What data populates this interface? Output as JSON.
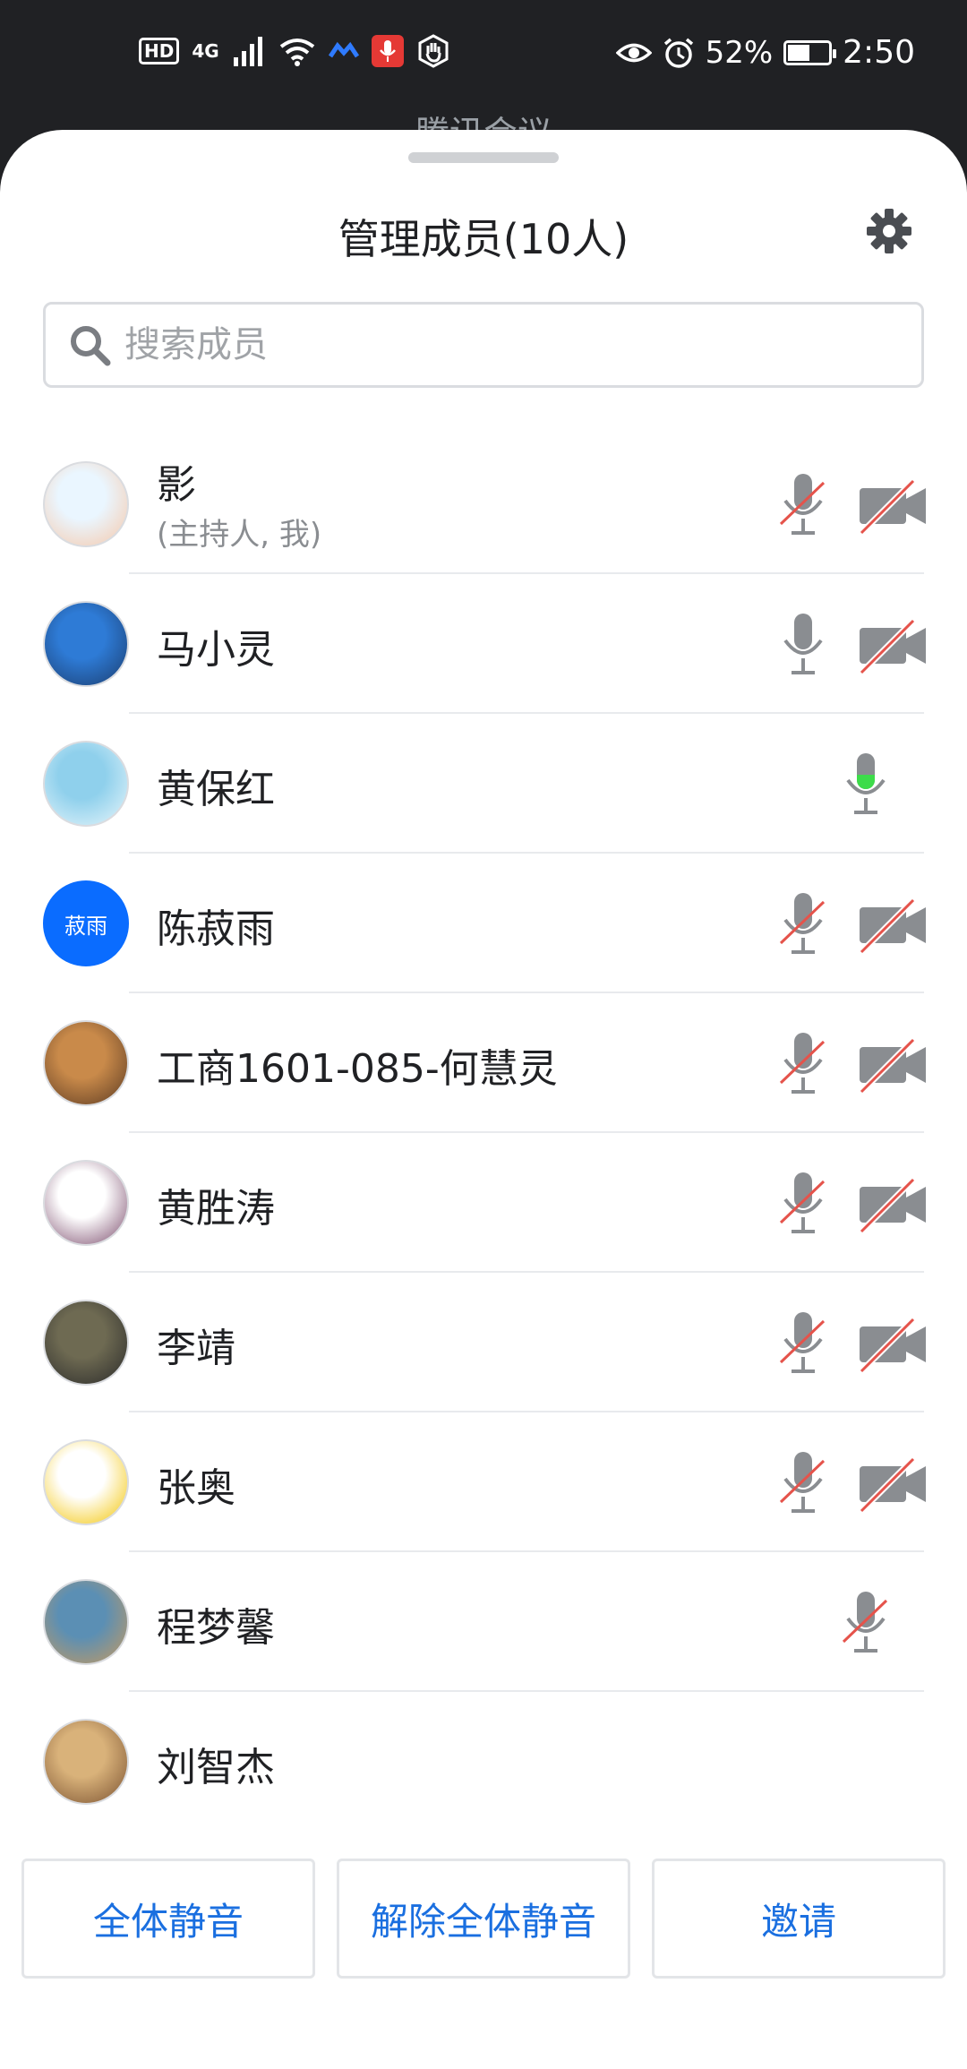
{
  "status_bar": {
    "hd": "HD",
    "network": "4G",
    "battery_percent": "52%",
    "time": "2:50",
    "battery_level": 0.52
  },
  "behind_title": "腾讯会议",
  "sheet": {
    "title": "管理成员(10人)",
    "search_placeholder": "搜索成员"
  },
  "members": [
    {
      "name": "影",
      "sub": "(主持人, 我)",
      "mic": "muted",
      "camera": "off",
      "avatar_colors": [
        "#eaf6ff",
        "#f6c7a8"
      ]
    },
    {
      "name": "马小灵",
      "sub": "",
      "mic": "on",
      "camera": "off",
      "avatar_colors": [
        "#2e7bd6",
        "#1b3d6e"
      ]
    },
    {
      "name": "黄保红",
      "sub": "",
      "mic": "active",
      "camera": "none",
      "avatar_colors": [
        "#8fd0ec",
        "#e8f6fb"
      ]
    },
    {
      "name": "陈菽雨",
      "sub": "",
      "avatar_text": "菽雨",
      "mic": "muted",
      "camera": "off",
      "avatar_colors": [
        "#0a6cff",
        "#0a6cff"
      ]
    },
    {
      "name": "工商1601-085-何慧灵",
      "sub": "",
      "mic": "muted",
      "camera": "off",
      "avatar_colors": [
        "#c98a4a",
        "#5b3a22"
      ]
    },
    {
      "name": "黄胜涛",
      "sub": "",
      "mic": "muted",
      "camera": "off",
      "avatar_colors": [
        "#ffffff",
        "#7a4a6b"
      ]
    },
    {
      "name": "李靖",
      "sub": "",
      "mic": "muted",
      "camera": "off",
      "avatar_colors": [
        "#6e6a52",
        "#2a2a2a"
      ]
    },
    {
      "name": "张奥",
      "sub": "",
      "mic": "muted",
      "camera": "off",
      "avatar_colors": [
        "#ffffff",
        "#f3c400"
      ]
    },
    {
      "name": "程梦馨",
      "sub": "",
      "mic": "muted",
      "camera": "none",
      "avatar_colors": [
        "#5b8fb4",
        "#c79a5f"
      ]
    },
    {
      "name": "刘智杰",
      "sub": "",
      "mic": "none",
      "camera": "none",
      "avatar_colors": [
        "#d9b27a",
        "#7a5130"
      ]
    }
  ],
  "buttons": {
    "mute_all": "全体静音",
    "unmute_all": "解除全体静音",
    "invite": "邀请"
  },
  "colors": {
    "accent": "#1a6fe0",
    "muted_slash": "#e5534b",
    "icon_gray": "#8a8d91",
    "mic_active": "#3ddc4a",
    "avatar_blue": "#0a6cff"
  }
}
